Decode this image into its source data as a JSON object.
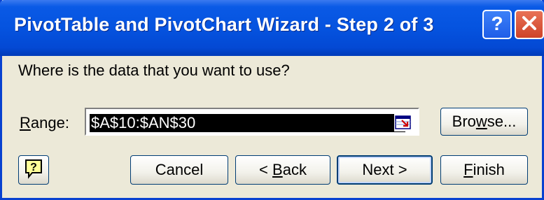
{
  "window": {
    "title": "PivotTable and PivotChart Wizard - Step 2 of 3",
    "help_icon": "help-question-icon",
    "close_icon": "close-x-icon"
  },
  "dialog": {
    "prompt": "Where is the data that you want to use?",
    "range_label_access": "R",
    "range_label_rest": "ange:",
    "range_value": "$A$10:$AN$30",
    "collapse_icon": "range-collapse-icon"
  },
  "buttons": {
    "browse_pre": "Bro",
    "browse_access": "w",
    "browse_post": "se...",
    "cancel": "Cancel",
    "back_pre": "< ",
    "back_access": "B",
    "back_post": "ack",
    "next": "Next >",
    "finish_access": "F",
    "finish_post": "inish",
    "help_icon": "assistant-help-icon"
  },
  "colors": {
    "title_bar": "#0553df",
    "dialog_bg": "#ece9d8",
    "selection": "#000000",
    "button_border": "#003c74"
  }
}
